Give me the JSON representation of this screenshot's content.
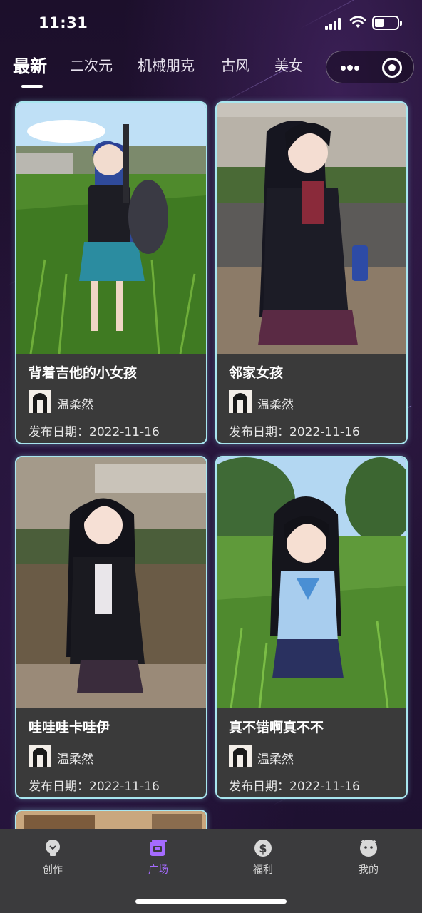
{
  "status_bar": {
    "time": "11:31"
  },
  "tabs": [
    {
      "label": "最新",
      "active": true
    },
    {
      "label": "二次元",
      "active": false
    },
    {
      "label": "机械朋克",
      "active": false
    },
    {
      "label": "古风",
      "active": false
    },
    {
      "label": "美女",
      "active": false
    }
  ],
  "capsule": {
    "more_icon": "more-dots-icon",
    "close_icon": "target-circle-icon"
  },
  "cards": [
    {
      "title": "背着吉他的小女孩",
      "author": "温柔然",
      "date_label": "发布日期：",
      "date": "2022-11-16",
      "image": "girl-with-guitar"
    },
    {
      "title": "邻家女孩",
      "author": "温柔然",
      "date_label": "发布日期：",
      "date": "2022-11-16",
      "image": "girl-next-door"
    },
    {
      "title": "哇哇哇卡哇伊",
      "author": "温柔然",
      "date_label": "发布日期：",
      "date": "2022-11-16",
      "image": "girl-by-pond"
    },
    {
      "title": "真不错啊真不不",
      "author": "温柔然",
      "date_label": "发布日期：",
      "date": "2022-11-16",
      "image": "girl-in-grass"
    }
  ],
  "bottom_nav": [
    {
      "label": "创作",
      "icon": "lightbulb-icon",
      "active": false
    },
    {
      "label": "广场",
      "icon": "gallery-icon",
      "active": true
    },
    {
      "label": "福利",
      "icon": "dollar-coin-icon",
      "active": false
    },
    {
      "label": "我的",
      "icon": "profile-face-icon",
      "active": false
    }
  ],
  "colors": {
    "accent": "#a56bff",
    "card_border": "#a8e6ef",
    "card_bg": "#3a3a3a",
    "nav_bg": "#3b3b3d"
  }
}
